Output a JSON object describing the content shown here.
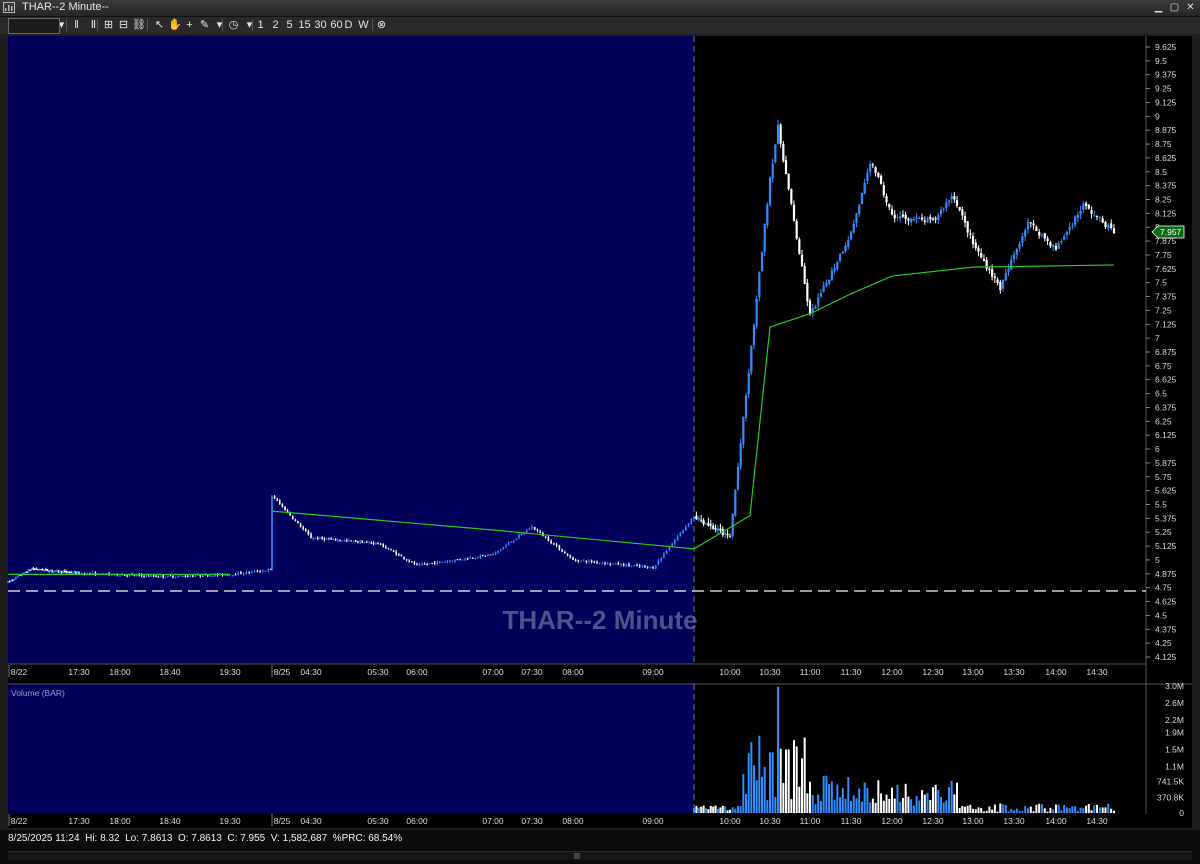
{
  "window": {
    "title": "THAR--2 Minute--"
  },
  "toolbar": {
    "items": [
      {
        "name": "dropdown-icon",
        "label": "▾"
      },
      {
        "name": "bar-spacing-icon",
        "label": "‖"
      },
      {
        "name": "ii-icon",
        "label": "Ⅱ"
      },
      {
        "name": "grid-icon",
        "label": "⊞"
      },
      {
        "name": "layout-icon",
        "label": "⊟"
      },
      {
        "name": "link-icon",
        "label": "⛓"
      },
      {
        "name": "cursor-icon",
        "label": "↖"
      },
      {
        "name": "hand-icon",
        "label": "✋"
      },
      {
        "name": "crosshair-icon",
        "label": "+"
      },
      {
        "name": "draw-icon",
        "label": "✎"
      },
      {
        "name": "draw-dropdown-icon",
        "label": "▾"
      },
      {
        "name": "clock-icon",
        "label": "◷"
      },
      {
        "name": "clock-dropdown-icon",
        "label": "▾"
      }
    ],
    "intervals": [
      "1",
      "2",
      "5",
      "15",
      "30",
      "60",
      "D",
      "W"
    ],
    "close_label": "⊗"
  },
  "chart": {
    "watermark": "THAR--2 Minute",
    "current_price_label": "7.957",
    "price_axis_labels": [
      "9.625",
      "9.5",
      "9.375",
      "9.25",
      "9.125",
      "9",
      "8.875",
      "8.75",
      "8.625",
      "8.5",
      "8.375",
      "8.25",
      "8.125",
      "8",
      "7.875",
      "7.75",
      "7.625",
      "7.5",
      "7.375",
      "7.25",
      "7.125",
      "7",
      "6.875",
      "6.75",
      "6.625",
      "6.5",
      "6.375",
      "6.25",
      "6.125",
      "6",
      "5.875",
      "5.75",
      "5.625",
      "5.5",
      "5.375",
      "5.25",
      "5.125",
      "5",
      "4.875",
      "4.75",
      "4.625",
      "4.5",
      "4.375",
      "4.25",
      "4.125"
    ],
    "time_labels": [
      "8/22",
      "17:30",
      "18:00",
      "18:40",
      "19:30",
      "8/25",
      "04:30",
      "05:30",
      "06:00",
      "07:00",
      "07:30",
      "08:00",
      "09:00",
      "10:00",
      "10:30",
      "11:00",
      "11:30",
      "12:00",
      "12:30",
      "13:00",
      "13:30",
      "14:00",
      "14:30"
    ],
    "colors": {
      "premarket_bg": "#00005a",
      "session_bg": "#000000",
      "up": "#2f8cff",
      "down": "#ffffff",
      "vwap": "#22cc22",
      "grid_line": "#cfcfcf"
    }
  },
  "volume": {
    "title": "Volume (BAR)",
    "axis_labels": [
      "3.0M",
      "2.6M",
      "2.2M",
      "1.9M",
      "1.5M",
      "1.1M",
      "741.5K",
      "370.8K",
      "0"
    ],
    "time_labels": [
      "8/22",
      "17:30",
      "18:00",
      "18:40",
      "19:30",
      "8/25",
      "04:30",
      "05:30",
      "06:00",
      "07:00",
      "07:30",
      "08:00",
      "09:00",
      "10:00",
      "10:30",
      "11:00",
      "11:30",
      "12:00",
      "12:30",
      "13:00",
      "13:30",
      "14:00",
      "14:30"
    ]
  },
  "status": {
    "text": "8/25/2025 11:24  Hi: 8.32  Lo: 7.8613  O: 7.8613  C: 7.955  V: 1,582,687  %PRC: 68.54%"
  },
  "chart_data": {
    "type": "candlestick",
    "xlabel": "",
    "ylabel": "",
    "ylim": [
      4.05,
      9.69
    ],
    "anchors": [
      {
        "t": "8/22 16:00",
        "close": 4.8
      },
      {
        "t": "8/22 16:30",
        "close": 4.92
      },
      {
        "t": "8/22 17:30",
        "close": 4.88
      },
      {
        "t": "8/22 18:40",
        "close": 4.85
      },
      {
        "t": "8/22 19:30",
        "close": 4.87
      },
      {
        "t": "8/25 04:00",
        "close": 5.58
      },
      {
        "t": "8/25 04:30",
        "close": 5.2
      },
      {
        "t": "8/25 05:30",
        "close": 5.15
      },
      {
        "t": "8/25 06:00",
        "close": 4.95
      },
      {
        "t": "8/25 07:00",
        "close": 5.05
      },
      {
        "t": "8/25 07:30",
        "close": 5.3
      },
      {
        "t": "8/25 08:00",
        "close": 5.0
      },
      {
        "t": "8/25 09:00",
        "close": 4.93
      },
      {
        "t": "8/25 09:30",
        "close": 5.4
      },
      {
        "t": "8/25 10:00",
        "close": 5.2
      },
      {
        "t": "8/25 10:15",
        "close": 6.8
      },
      {
        "t": "8/25 10:30",
        "close": 8.45
      },
      {
        "t": "8/25 10:36",
        "close": 8.9
      },
      {
        "t": "8/25 11:00",
        "close": 7.2
      },
      {
        "t": "8/25 11:30",
        "close": 7.95
      },
      {
        "t": "8/25 11:45",
        "close": 8.6
      },
      {
        "t": "8/25 12:00",
        "close": 8.1
      },
      {
        "t": "8/25 12:30",
        "close": 8.05
      },
      {
        "t": "8/25 12:45",
        "close": 8.3
      },
      {
        "t": "8/25 13:00",
        "close": 7.85
      },
      {
        "t": "8/25 13:20",
        "close": 7.45
      },
      {
        "t": "8/25 13:40",
        "close": 8.05
      },
      {
        "t": "8/25 14:00",
        "close": 7.8
      },
      {
        "t": "8/25 14:20",
        "close": 8.2
      },
      {
        "t": "8/25 14:42",
        "close": 7.96
      }
    ],
    "vwap": [
      {
        "t": "8/22 16:00",
        "v": 4.87
      },
      {
        "t": "8/22 19:30",
        "v": 4.87
      },
      {
        "t": "8/25 04:00",
        "v": 5.44
      },
      {
        "t": "8/25 07:00",
        "v": 5.27
      },
      {
        "t": "8/25 09:30",
        "v": 5.1
      },
      {
        "t": "8/25 10:15",
        "v": 5.4
      },
      {
        "t": "8/25 10:30",
        "v": 7.1
      },
      {
        "t": "8/25 11:00",
        "v": 7.22
      },
      {
        "t": "8/25 11:30",
        "v": 7.4
      },
      {
        "t": "8/25 12:00",
        "v": 7.56
      },
      {
        "t": "8/25 13:00",
        "v": 7.64
      },
      {
        "t": "8/25 14:42",
        "v": 7.66
      }
    ],
    "reference_line": 4.72,
    "last_price": 7.957,
    "volume_max": 3000000
  }
}
